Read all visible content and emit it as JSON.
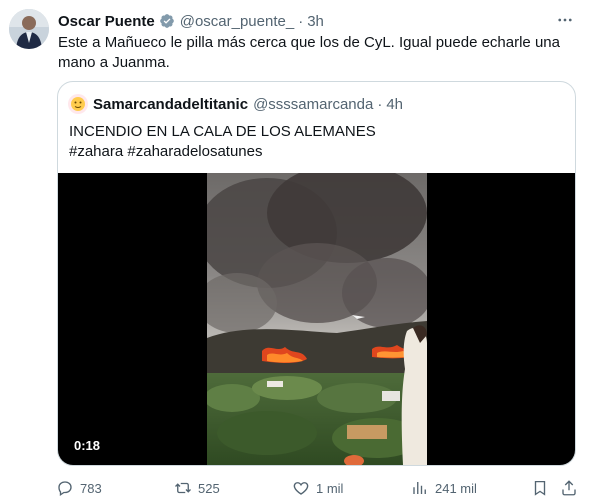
{
  "tweet": {
    "author_name": "Oscar Puente",
    "handle": "@oscar_puente_",
    "separator": "·",
    "time": "3h",
    "text": "Este a Mañueco le pilla más cerca que los de CyL. Igual puede echarle una mano a Juanma."
  },
  "quote": {
    "author_name": "Samarcandadeltitanic",
    "handle": "@ssssamarcanda",
    "separator": "·",
    "time": "4h",
    "text_line1": "INCENDIO EN LA CALA DE LOS ALEMANES",
    "hashtag1": "#zahara",
    "hashtag2": "#zaharadelosatunes",
    "video_duration": "0:18"
  },
  "actions": {
    "replies": "783",
    "reposts": "525",
    "likes": "1 mil",
    "views": "241 mil"
  },
  "icons": {
    "verified": "verified-badge-icon",
    "more": "more-icon",
    "reply": "reply-icon",
    "repost": "repost-icon",
    "like": "like-icon",
    "views": "views-icon",
    "bookmark": "bookmark-icon",
    "share": "share-icon"
  },
  "colors": {
    "text": "#0f1419",
    "secondary": "#536471",
    "border": "#cfd9de",
    "verified": "#829aab"
  }
}
